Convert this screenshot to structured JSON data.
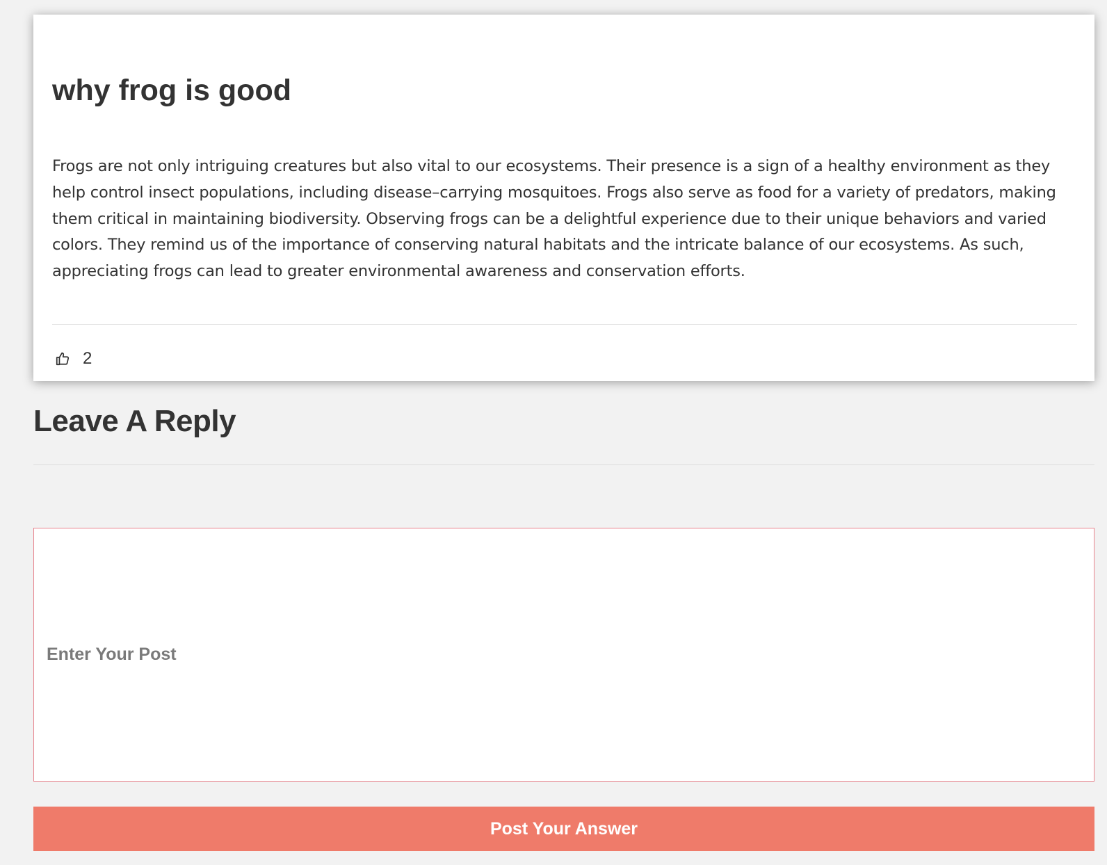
{
  "post": {
    "title": "why frog is good",
    "body": "Frogs are not only intriguing creatures but also vital to our ecosystems. Their presence is a sign of a healthy environment as they help control insect populations, including disease–carrying mosquitoes. Frogs also serve as food for a variety of predators, making them critical in maintaining biodiversity. Observing frogs can be a delightful experience due to their unique behaviors and varied colors. They remind us of the importance of conserving natural habitats and the intricate balance of our ecosystems. As such, appreciating frogs can lead to greater environmental awareness and conservation efforts.",
    "like_icon": "thumbs-up-icon",
    "like_count": "2"
  },
  "reply": {
    "heading": "Leave A Reply",
    "input_placeholder": "Enter Your Post",
    "input_value": "",
    "submit_label": "Post Your Answer"
  },
  "colors": {
    "background": "#f2f2f2",
    "card": "#ffffff",
    "text": "#333333",
    "input_border": "#e8828c",
    "placeholder": "#7a7a7a",
    "button": "#ef7b6a",
    "button_text": "#ffffff"
  }
}
